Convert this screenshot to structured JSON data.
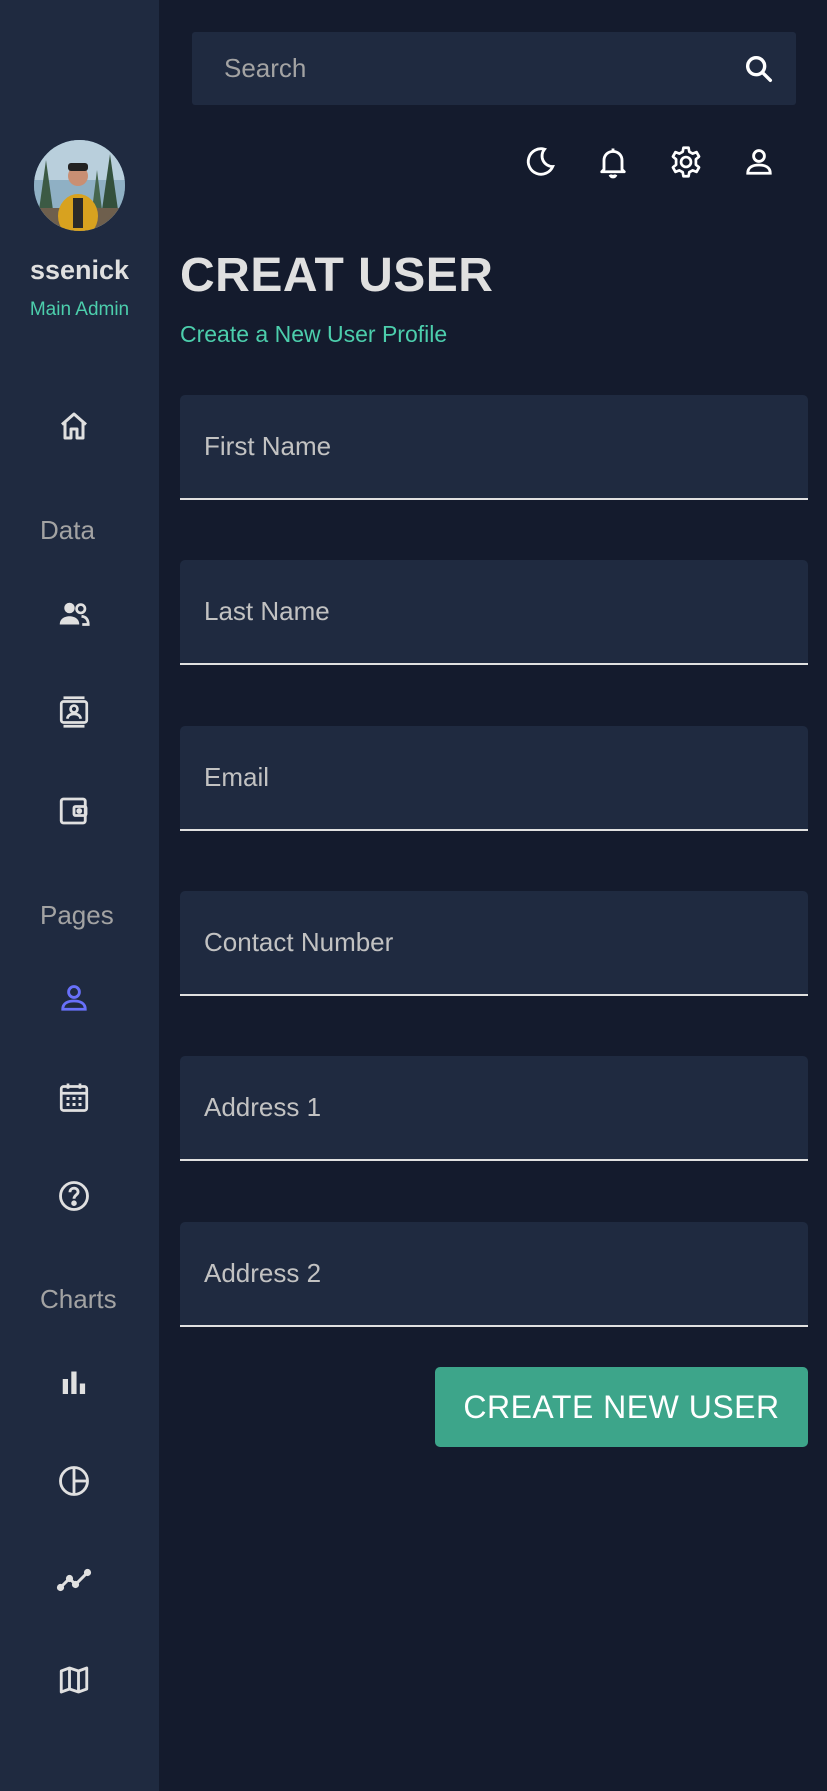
{
  "sidebar": {
    "user": {
      "name": "ssenick",
      "role": "Main Admin"
    },
    "sections": {
      "data": "Data",
      "pages": "Pages",
      "charts": "Charts"
    },
    "items": [
      {
        "icon": "home-icon",
        "active": false
      },
      {
        "icon": "team-icon",
        "active": false
      },
      {
        "icon": "contacts-icon",
        "active": false
      },
      {
        "icon": "invoices-icon",
        "active": false
      },
      {
        "icon": "person-icon",
        "active": true
      },
      {
        "icon": "calendar-icon",
        "active": false
      },
      {
        "icon": "help-icon",
        "active": false
      },
      {
        "icon": "bar-chart-icon",
        "active": false
      },
      {
        "icon": "pie-chart-icon",
        "active": false
      },
      {
        "icon": "line-chart-icon",
        "active": false
      },
      {
        "icon": "map-icon",
        "active": false
      }
    ]
  },
  "topbar": {
    "search": {
      "placeholder": "Search"
    },
    "icons": [
      "dark-mode-icon",
      "notifications-icon",
      "settings-icon",
      "profile-icon"
    ]
  },
  "header": {
    "title": "CREAT USER",
    "subtitle": "Create a New User Profile"
  },
  "form": {
    "fields": {
      "first_name": {
        "placeholder": "First Name",
        "value": ""
      },
      "last_name": {
        "placeholder": "Last Name",
        "value": ""
      },
      "email": {
        "placeholder": "Email",
        "value": ""
      },
      "contact": {
        "placeholder": "Contact Number",
        "value": ""
      },
      "address1": {
        "placeholder": "Address 1",
        "value": ""
      },
      "address2": {
        "placeholder": "Address 2",
        "value": ""
      }
    },
    "submit_label": "CREATE NEW USER"
  },
  "colors": {
    "background": "#141b2d",
    "panel": "#1f2a40",
    "accent_green": "#4cceac",
    "button_green": "#3da58a",
    "active_icon": "#6870fa",
    "text": "#e0e0e0",
    "muted": "#a3a3a3"
  }
}
